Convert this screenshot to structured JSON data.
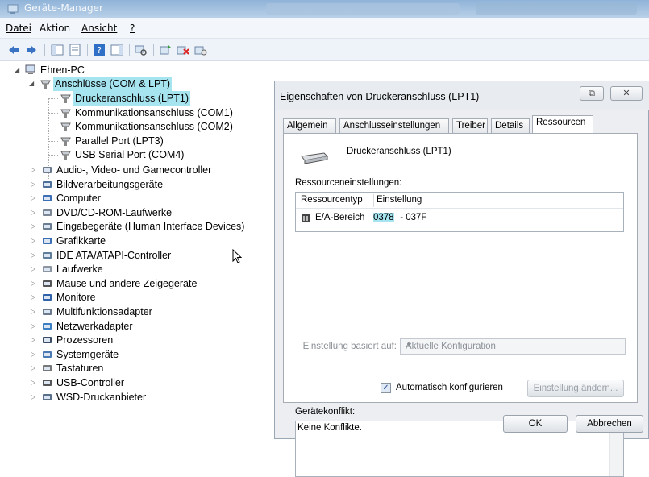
{
  "window": {
    "title": "Geräte-Manager"
  },
  "menu": {
    "datei": "Datei",
    "aktion": "Aktion",
    "ansicht": "Ansicht",
    "help": "?"
  },
  "toolbar_icons": [
    "back-icon",
    "forward-icon",
    "show-hide-console-tree-icon",
    "properties-icon",
    "help-icon",
    "show-action-pane-icon",
    "scan-hardware-icon",
    "update-driver-icon",
    "uninstall-icon",
    "disable-icon"
  ],
  "tree": {
    "root": "Ehren-PC",
    "ports": "Anschlüsse (COM & LPT)",
    "ports_children": [
      "Druckeranschluss (LPT1)",
      "Kommunikationsanschluss (COM1)",
      "Kommunikationsanschluss (COM2)",
      "Parallel Port (LPT3)",
      "USB Serial Port (COM4)"
    ],
    "categories": [
      "Audio-, Video- und Gamecontroller",
      "Bildverarbeitungsgeräte",
      "Computer",
      "DVD/CD-ROM-Laufwerke",
      "Eingabegeräte (Human Interface Devices)",
      "Grafikkarte",
      "IDE ATA/ATAPI-Controller",
      "Laufwerke",
      "Mäuse und andere Zeigegeräte",
      "Monitore",
      "Multifunktionsadapter",
      "Netzwerkadapter",
      "Prozessoren",
      "Systemgeräte",
      "Tastaturen",
      "USB-Controller",
      "WSD-Druckanbieter"
    ]
  },
  "dialog": {
    "title": "Eigenschaften von Druckeranschluss (LPT1)",
    "tabs": [
      "Allgemein",
      "Anschlusseinstellungen",
      "Treiber",
      "Details",
      "Ressourcen"
    ],
    "device_name": "Druckeranschluss (LPT1)",
    "resource_settings_label": "Ressourceneinstellungen:",
    "col_type": "Ressourcentyp",
    "col_setting": "Einstellung",
    "row_type": "E/A-Bereich",
    "row_setting_start": "0378",
    "row_setting_end": " - 037F",
    "based_on_label": "Einstellung basiert auf:",
    "based_on_value": "Aktuelle Konfiguration",
    "auto_config_label": "Automatisch konfigurieren",
    "auto_config_checked": true,
    "change_setting_button": "Einstellung ändern...",
    "conflict_label": "Gerätekonflikt:",
    "conflict_text": "Keine Konflikte.",
    "ok_button": "OK",
    "cancel_button": "Abbrechen"
  },
  "colors": {
    "selection": "#a6e4f0",
    "titlebar": "#8fb3d8"
  }
}
